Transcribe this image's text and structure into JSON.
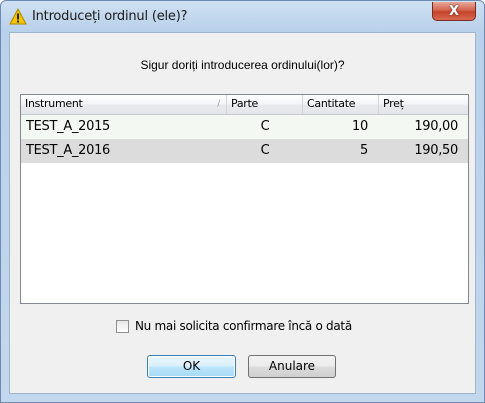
{
  "window": {
    "title": "Introduceți ordinul (ele)?",
    "close_glyph": "X",
    "icon": "warning-icon"
  },
  "dialog": {
    "question": "Sigur doriți introducerea ordinului(lor)?"
  },
  "table": {
    "columns": [
      "Instrument",
      "Parte",
      "Cantitate",
      "Preț"
    ],
    "sort_glyph": "/",
    "rows": [
      {
        "instrument": "TEST_A_2015",
        "parte": "C",
        "cantitate": "10",
        "pret": "190,00"
      },
      {
        "instrument": "TEST_A_2016",
        "parte": "C",
        "cantitate": "5",
        "pret": "190,50"
      }
    ]
  },
  "checkbox": {
    "label": "Nu mai solicita confirmare încă o dată",
    "checked": false
  },
  "buttons": {
    "ok": "OK",
    "cancel": "Anulare"
  },
  "colors": {
    "warning_yellow": "#f5c400",
    "selected_row": "#dcdcdc",
    "ok_border": "#3c7fb1"
  }
}
